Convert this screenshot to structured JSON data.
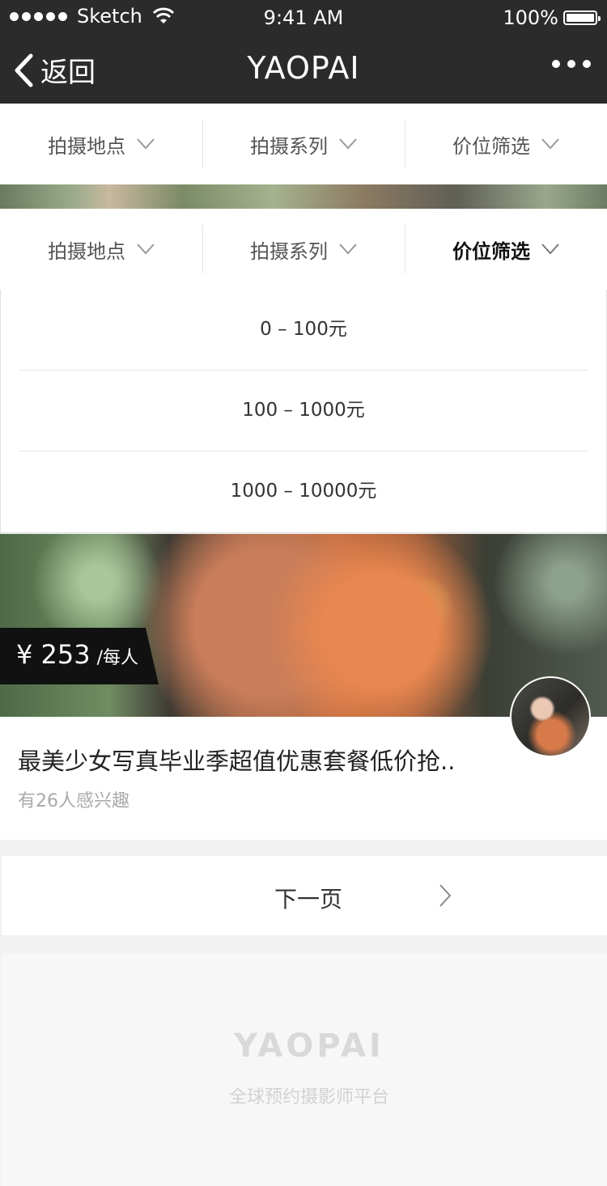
{
  "status_bar": {
    "carrier": "Sketch",
    "time": "9:41 AM",
    "battery": "100%"
  },
  "nav": {
    "back_label": "返回",
    "title": "YAOPAI"
  },
  "filters": [
    {
      "label": "拍摄地点"
    },
    {
      "label": "拍摄系列"
    },
    {
      "label": "价位筛选"
    }
  ],
  "price_options": [
    "0 – 100元",
    "100 – 1000元",
    "1000 – 10000元"
  ],
  "card": {
    "price": "¥ 253",
    "price_unit": "/每人",
    "title": "最美少女写真毕业季超值优惠套餐低价抢..",
    "subtitle": "有26人感兴趣"
  },
  "pagination": {
    "next_label": "下一页"
  },
  "footer": {
    "logo": "YAOPAI",
    "tagline": "全球预约摄影师平台"
  },
  "colors": {
    "nav_bg": "#2b2b2b",
    "page_bg": "#f2f2f2",
    "text": "#333333",
    "muted": "#aaaaaa"
  }
}
